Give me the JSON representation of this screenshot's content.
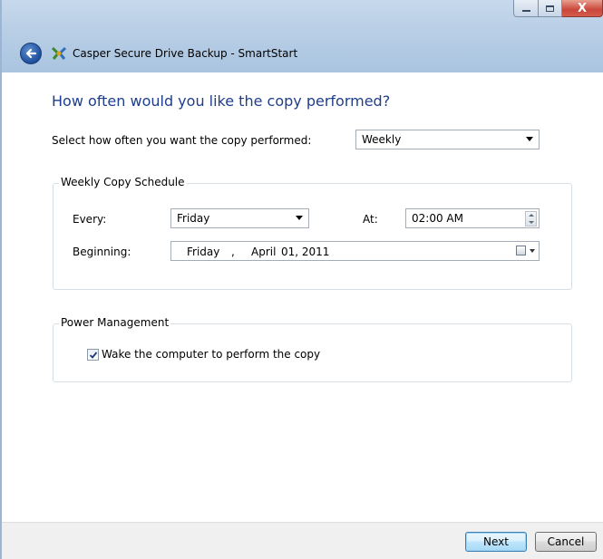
{
  "window": {
    "title": "Casper Secure Drive Backup - SmartStart",
    "minimize_glyph": "▁",
    "maximize_glyph": "▢",
    "close_glyph": "X"
  },
  "page": {
    "heading": "How often would you like the copy performed?",
    "frequency_label": "Select how often you want the copy performed:",
    "frequency_value": "Weekly"
  },
  "weekly_schedule": {
    "group_title": "Weekly Copy Schedule",
    "every_label": "Every:",
    "every_value": "Friday",
    "at_label": "At:",
    "at_value": "02:00 AM",
    "beginning_label": "Beginning:",
    "beginning_weekday": "Friday",
    "beginning_sep": ",",
    "beginning_month": "April",
    "beginning_day_year": "01, 2011"
  },
  "power": {
    "group_title": "Power Management",
    "wake_label": "Wake the computer to perform the copy",
    "wake_checked": true
  },
  "footer": {
    "next_label": "Next",
    "cancel_label": "Cancel"
  },
  "colors": {
    "heading": "#1e3e8c",
    "titlebar": "#b9cfe6"
  },
  "icons": {
    "back": "back-arrow-icon",
    "app": "casper-app-icon",
    "calendar": "calendar-icon",
    "dropdown": "chevron-down-icon"
  }
}
